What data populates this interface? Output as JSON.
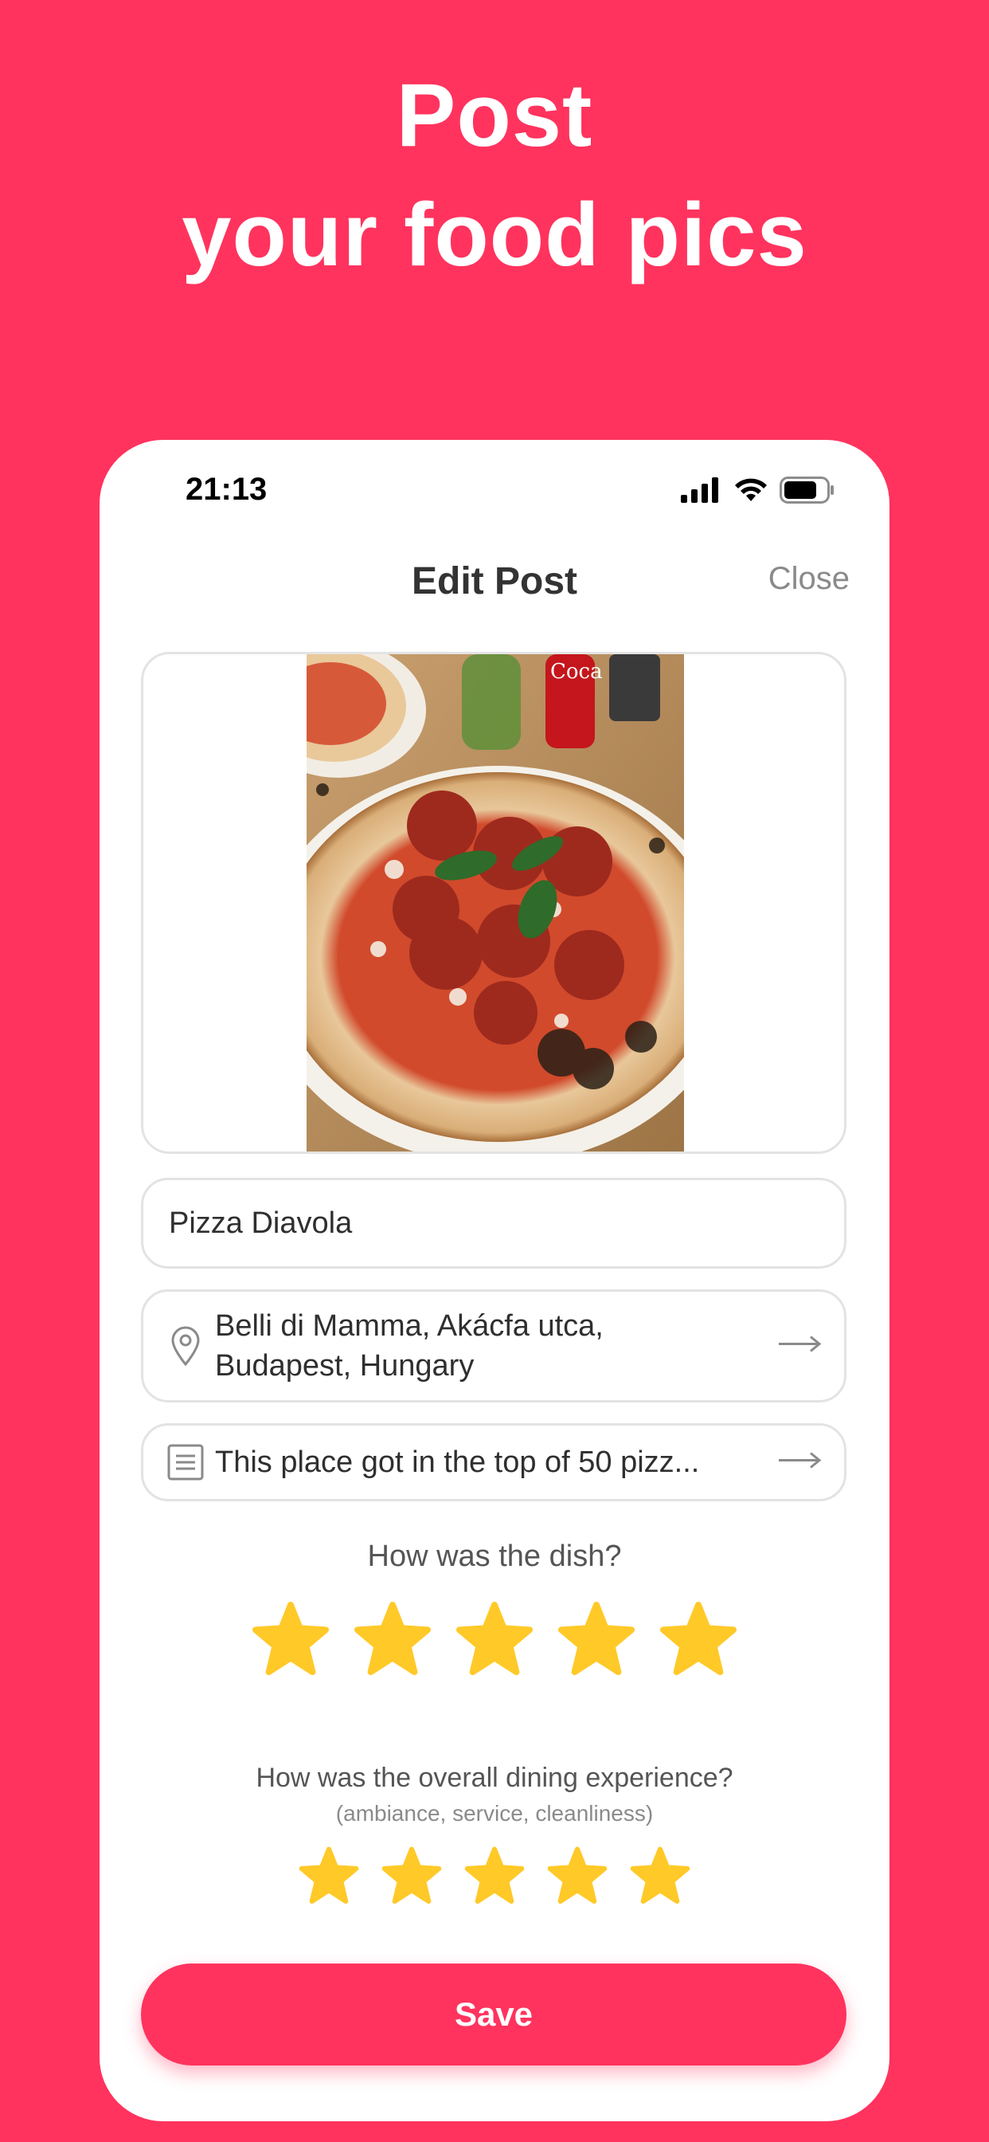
{
  "headline": {
    "line1": "Post",
    "line2": "your food pics"
  },
  "status_bar": {
    "time": "21:13"
  },
  "nav": {
    "title": "Edit Post",
    "close_label": "Close"
  },
  "photo": {
    "icon": "food-photo"
  },
  "dish_name": {
    "value": "Pizza Diavola"
  },
  "location": {
    "line1": "Belli di Mamma, Akácfa utca,",
    "line2": "Budapest, Hungary",
    "icon": "location-pin-icon"
  },
  "notes": {
    "value": "This place got in the top of 50 pizz...",
    "icon": "document-icon"
  },
  "dish_rating": {
    "question": "How was the dish?",
    "value": 5,
    "max": 5
  },
  "experience_rating": {
    "question": "How was the overall dining experience?",
    "subtitle": "(ambiance, service, cleanliness)",
    "value": 5,
    "max": 5
  },
  "save_label": "Save",
  "colors": {
    "brand": "#ff335e",
    "star": "#ffc928",
    "border": "#e3e3e3"
  }
}
